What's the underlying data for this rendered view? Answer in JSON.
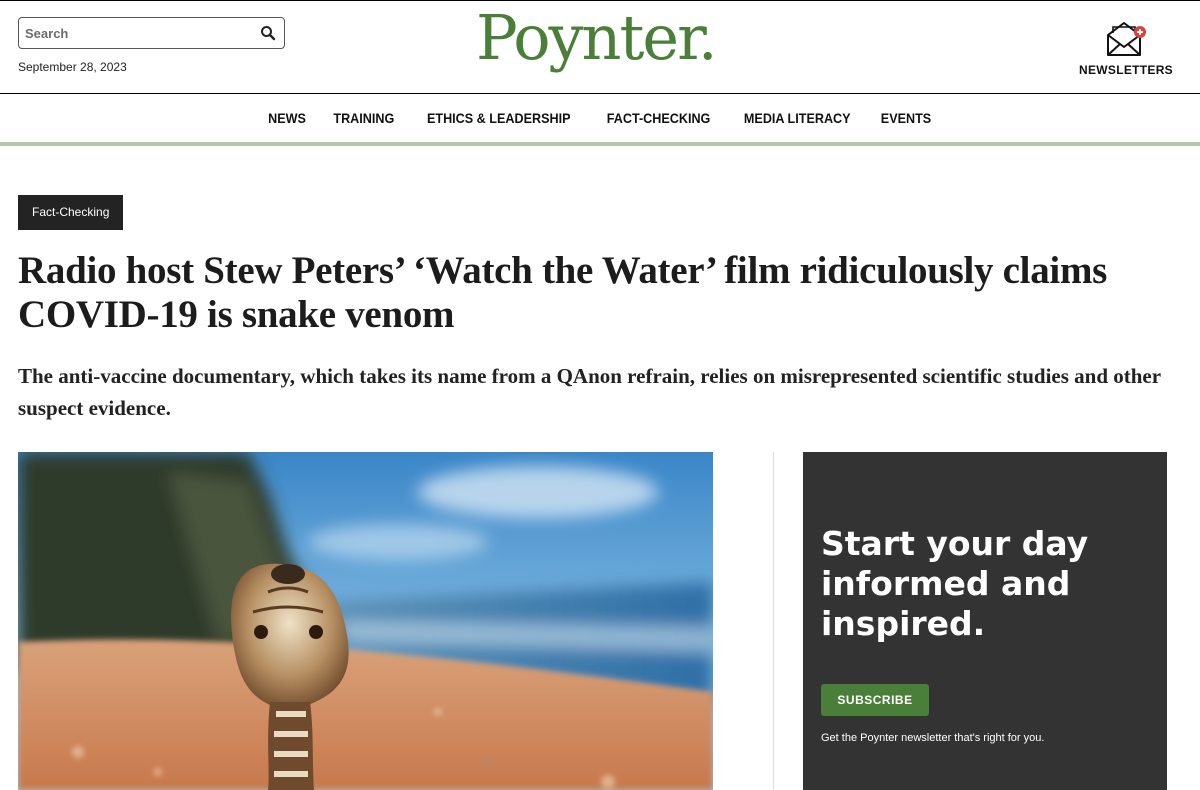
{
  "header": {
    "search_placeholder": "Search",
    "date": "September 28, 2023",
    "logo": "Poynter.",
    "newsletters_label": "NEWSLETTERS"
  },
  "nav": {
    "items": [
      "NEWS",
      "TRAINING",
      "ETHICS & LEADERSHIP",
      "FACT-CHECKING",
      "MEDIA LITERACY",
      "EVENTS"
    ]
  },
  "article": {
    "category": "Fact-Checking",
    "headline": "Radio host Stew Peters’ ‘Watch the Water’ film ridiculously claims COVID-19 is snake venom",
    "dek": "The anti-vaccine documentary, which takes its name from a QAnon refrain, relies on misrepresented scientific studies and other suspect evidence."
  },
  "promo": {
    "title": "Start your day informed and inspired.",
    "button": "SUBSCRIBE",
    "caption": "Get the Poynter newsletter that's right for you."
  },
  "colors": {
    "brand_green": "#4a7f3a",
    "nav_underline": "#b5c8a6",
    "tag_bg": "#232323",
    "promo_bg": "#333333"
  },
  "icons": [
    "search-icon",
    "envelope-icon",
    "plus-badge-icon"
  ]
}
